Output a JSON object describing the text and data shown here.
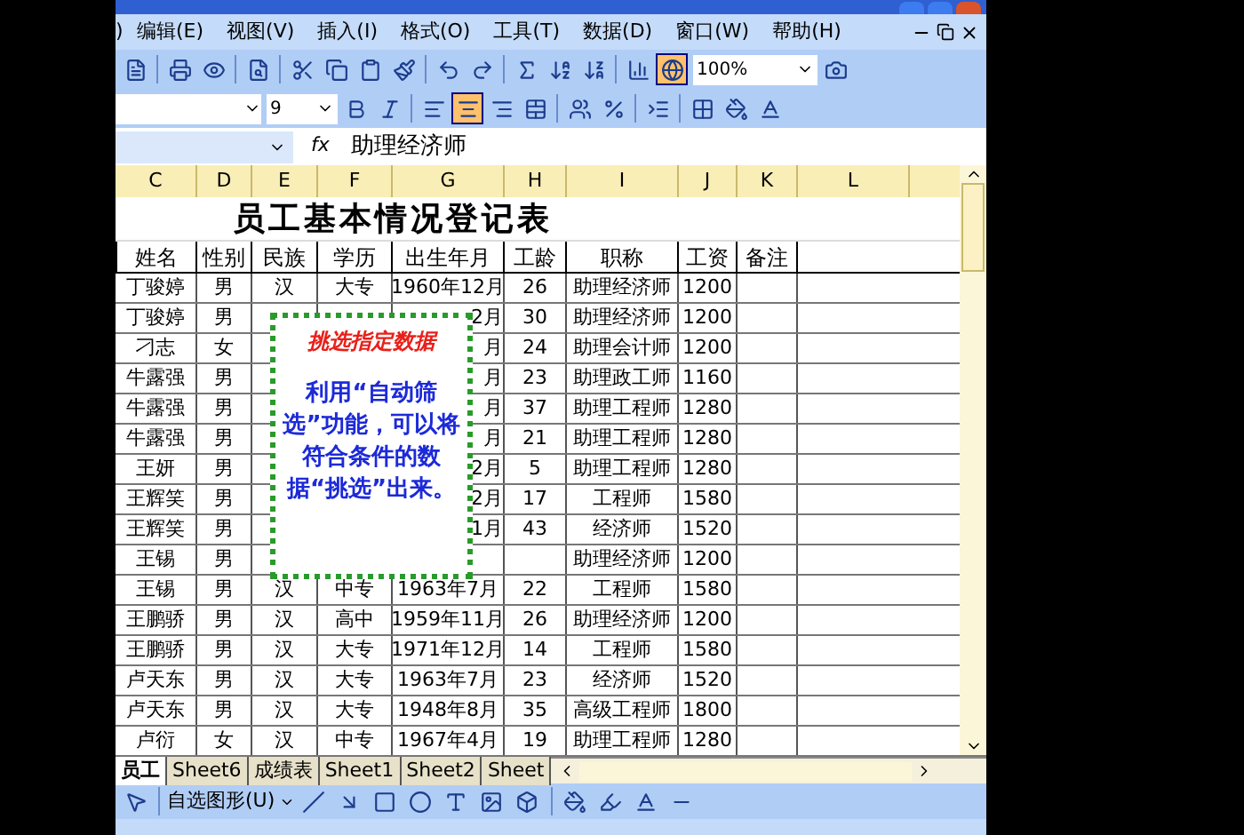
{
  "menu_bar": {
    "cut_item": ")",
    "items": [
      "编辑(E)",
      "视图(V)",
      "插入(I)",
      "格式(O)",
      "工具(T)",
      "数据(D)",
      "窗口(W)",
      "帮助(H)"
    ]
  },
  "standard_toolbar": {
    "drawing_on": true,
    "zoom": "100%"
  },
  "format_toolbar": {
    "font_size": "9",
    "align_buttons": [
      {
        "selected": false
      },
      {
        "selected": true
      },
      {
        "selected": false
      }
    ]
  },
  "formula_bar": {
    "fx": "fx",
    "value": "助理经济师"
  },
  "columns": [
    "C",
    "D",
    "E",
    "F",
    "G",
    "H",
    "I",
    "J",
    "K",
    "L"
  ],
  "sheet": {
    "title": "员工基本情况登记表",
    "headers": [
      "姓名",
      "性别",
      "民族",
      "学历",
      "出生年月",
      "工龄",
      "职称",
      "工资",
      "备注"
    ],
    "rows": [
      {
        "name": "丁骏婷",
        "gender": "男",
        "ethnicity": "汉",
        "education": "大专",
        "birth": "1960年12月",
        "years": "26",
        "title": "助理经济师",
        "salary": "1200"
      },
      {
        "name": "丁骏婷",
        "gender": "男",
        "birth": "2月",
        "years": "30",
        "title": "助理经济师",
        "salary": "1200"
      },
      {
        "name": "刁志",
        "gender": "女",
        "birth": "月",
        "years": "24",
        "title": "助理会计师",
        "salary": "1200"
      },
      {
        "name": "牛露强",
        "gender": "男",
        "birth": "月",
        "years": "23",
        "title": "助理政工师",
        "salary": "1160"
      },
      {
        "name": "牛露强",
        "gender": "男",
        "birth": "月",
        "years": "37",
        "title": "助理工程师",
        "salary": "1280"
      },
      {
        "name": "牛露强",
        "gender": "男",
        "birth": "月",
        "years": "21",
        "title": "助理工程师",
        "salary": "1280"
      },
      {
        "name": "王妍",
        "gender": "男",
        "birth": "2月",
        "years": "5",
        "title": "助理工程师",
        "salary": "1280"
      },
      {
        "name": "王辉笑",
        "gender": "男",
        "birth": "2月",
        "years": "17",
        "title": "工程师",
        "salary": "1580"
      },
      {
        "name": "王辉笑",
        "gender": "男",
        "birth": "1月",
        "years": "43",
        "title": "经济师",
        "salary": "1520"
      },
      {
        "name": "王锡",
        "gender": "男",
        "title": "助理经济师",
        "salary": "1200"
      },
      {
        "name": "王锡",
        "gender": "男",
        "ethnicity": "汉",
        "education": "中专",
        "birth": "1963年7月",
        "years": "22",
        "title": "工程师",
        "salary": "1580"
      },
      {
        "name": "王鹏骄",
        "gender": "男",
        "ethnicity": "汉",
        "education": "高中",
        "birth": "1959年11月",
        "years": "26",
        "title": "助理经济师",
        "salary": "1200"
      },
      {
        "name": "王鹏骄",
        "gender": "男",
        "ethnicity": "汉",
        "education": "大专",
        "birth": "1971年12月",
        "years": "14",
        "title": "工程师",
        "salary": "1580"
      },
      {
        "name": "卢天东",
        "gender": "男",
        "ethnicity": "汉",
        "education": "大专",
        "birth": "1963年7月",
        "years": "23",
        "title": "经济师",
        "salary": "1520"
      },
      {
        "name": "卢天东",
        "gender": "男",
        "ethnicity": "汉",
        "education": "大专",
        "birth": "1948年8月",
        "years": "35",
        "title": "高级工程师",
        "salary": "1800"
      },
      {
        "name": "卢衍",
        "gender": "女",
        "ethnicity": "汉",
        "education": "中专",
        "birth": "1967年4月",
        "years": "19",
        "title": "助理工程师",
        "salary": "1280"
      }
    ]
  },
  "callout": {
    "title": "挑选指定数据",
    "text": "利用“自动筛选”功能，可以将符合条件的数据“挑选”出来。"
  },
  "sheet_tabs": [
    {
      "label": "员工",
      "selected": true
    },
    {
      "label": "Sheet6",
      "selected": false
    },
    {
      "label": "成绩表",
      "selected": false
    },
    {
      "label": "Sheet1",
      "selected": false
    },
    {
      "label": "Sheet2",
      "selected": false
    },
    {
      "label": "Sheet",
      "selected": false
    }
  ],
  "drawing_toolbar": {
    "autoshapes": "自选图形(U)"
  }
}
